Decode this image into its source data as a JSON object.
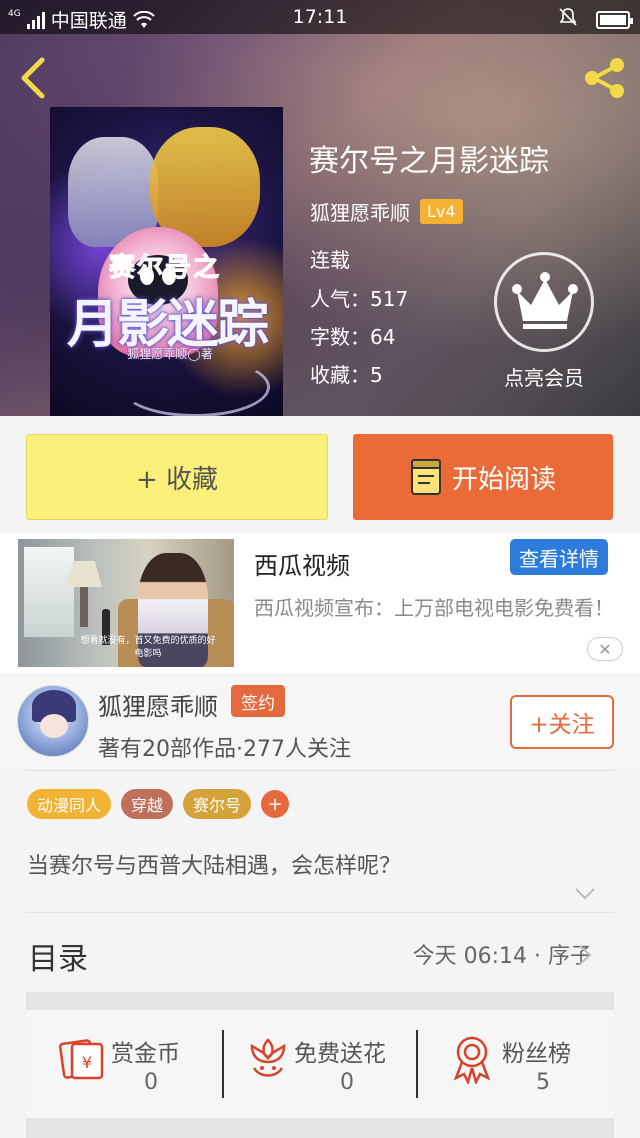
{
  "status_bar": {
    "network_type": "4G",
    "carrier": "中国联通",
    "time": "17:11"
  },
  "book": {
    "title": "赛尔号之月影迷踪",
    "author": "狐狸愿乖顺",
    "level_badge": "Lv4",
    "status": "连载",
    "popularity_label": "人气：517",
    "word_count_label": "字数：64",
    "favorites_label": "收藏：5",
    "member_label": "点亮会员",
    "cover": {
      "subtitle": "赛尔号之",
      "title": "月影迷踪",
      "author_line": "狐狸愿乖顺◯著"
    }
  },
  "actions": {
    "collect_label": "+ 收藏",
    "read_label": "开始阅读"
  },
  "ad": {
    "title": "西瓜视频",
    "detail_button": "查看详情",
    "description": "西瓜视频宣布：上万部电视电影免费看！",
    "thumb_caption": "想看就没有，首又免费的优质的好电影吗"
  },
  "author_section": {
    "name": "狐狸愿乖顺",
    "badge": "签约",
    "stats": "著有20部作品·277人关注",
    "follow_label": "+关注"
  },
  "tags": [
    {
      "label": "动漫同人",
      "color": "#f2b233"
    },
    {
      "label": "穿越",
      "color": "#c0705a"
    },
    {
      "label": "赛尔号",
      "color": "#d4a33a"
    }
  ],
  "synopsis": "当赛尔号与西普大陆相遇，会怎样呢？",
  "toc": {
    "label": "目录",
    "latest": "今天 06:14 · 序子"
  },
  "stats": [
    {
      "label": "赏金币",
      "value": "0",
      "icon": "reward-coin-icon"
    },
    {
      "label": "免费送花",
      "value": "0",
      "icon": "flower-icon"
    },
    {
      "label": "粉丝榜",
      "value": "5",
      "icon": "fan-rank-medal-icon"
    }
  ],
  "colors": {
    "accent_orange": "#e46a3e",
    "collect_yellow": "#fbf07a",
    "read_orange": "#ea6b38",
    "ad_blue": "#2d7cdb"
  }
}
